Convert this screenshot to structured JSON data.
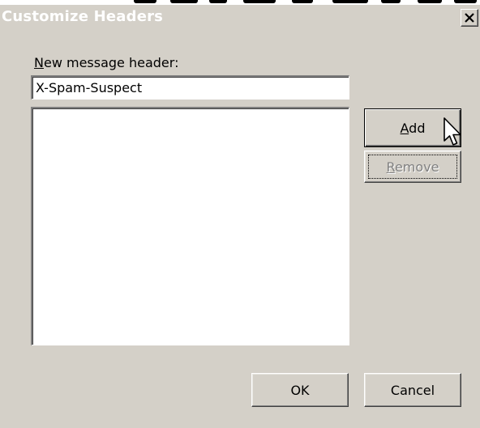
{
  "window": {
    "title": "Customize Headers",
    "close_glyph": "✕"
  },
  "form": {
    "new_header_label_key": "N",
    "new_header_label_rest": "ew message header:",
    "new_header_value": "X-Spam-Suspect",
    "headers_list": []
  },
  "buttons": {
    "add_key": "A",
    "add_rest": "dd",
    "remove_key": "R",
    "remove_rest": "emove",
    "ok": "OK",
    "cancel": "Cancel"
  },
  "icons": {
    "cursor": "arrow-pointer-icon",
    "close": "close-icon"
  },
  "colors": {
    "dialog_bg": "#d4d0c8",
    "title_text": "#ffffff",
    "disabled_text": "#808080",
    "input_bg": "#ffffff"
  }
}
